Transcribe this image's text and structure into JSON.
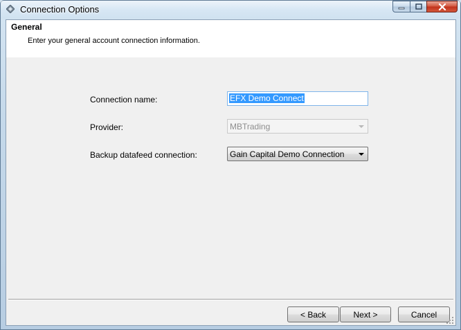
{
  "window": {
    "title": "Connection Options",
    "controls": {
      "minimize": "minimize",
      "maximize": "maximize",
      "close": "close"
    }
  },
  "header": {
    "title": "General",
    "description": "Enter your general account connection information."
  },
  "form": {
    "connection_name": {
      "label": "Connection name:",
      "value": "EFX Demo Connect"
    },
    "provider": {
      "label": "Provider:",
      "value": "MBTrading",
      "disabled": true
    },
    "backup": {
      "label": "Backup datafeed connection:",
      "value": "Gain Capital Demo Connection"
    }
  },
  "buttons": {
    "back": "< Back",
    "next": "Next >",
    "cancel": "Cancel"
  },
  "icons": {
    "app": "diamond-app-icon",
    "minimize": "minimize-icon",
    "maximize": "maximize-icon",
    "close": "close-icon",
    "dropdown": "chevron-down-icon"
  }
}
